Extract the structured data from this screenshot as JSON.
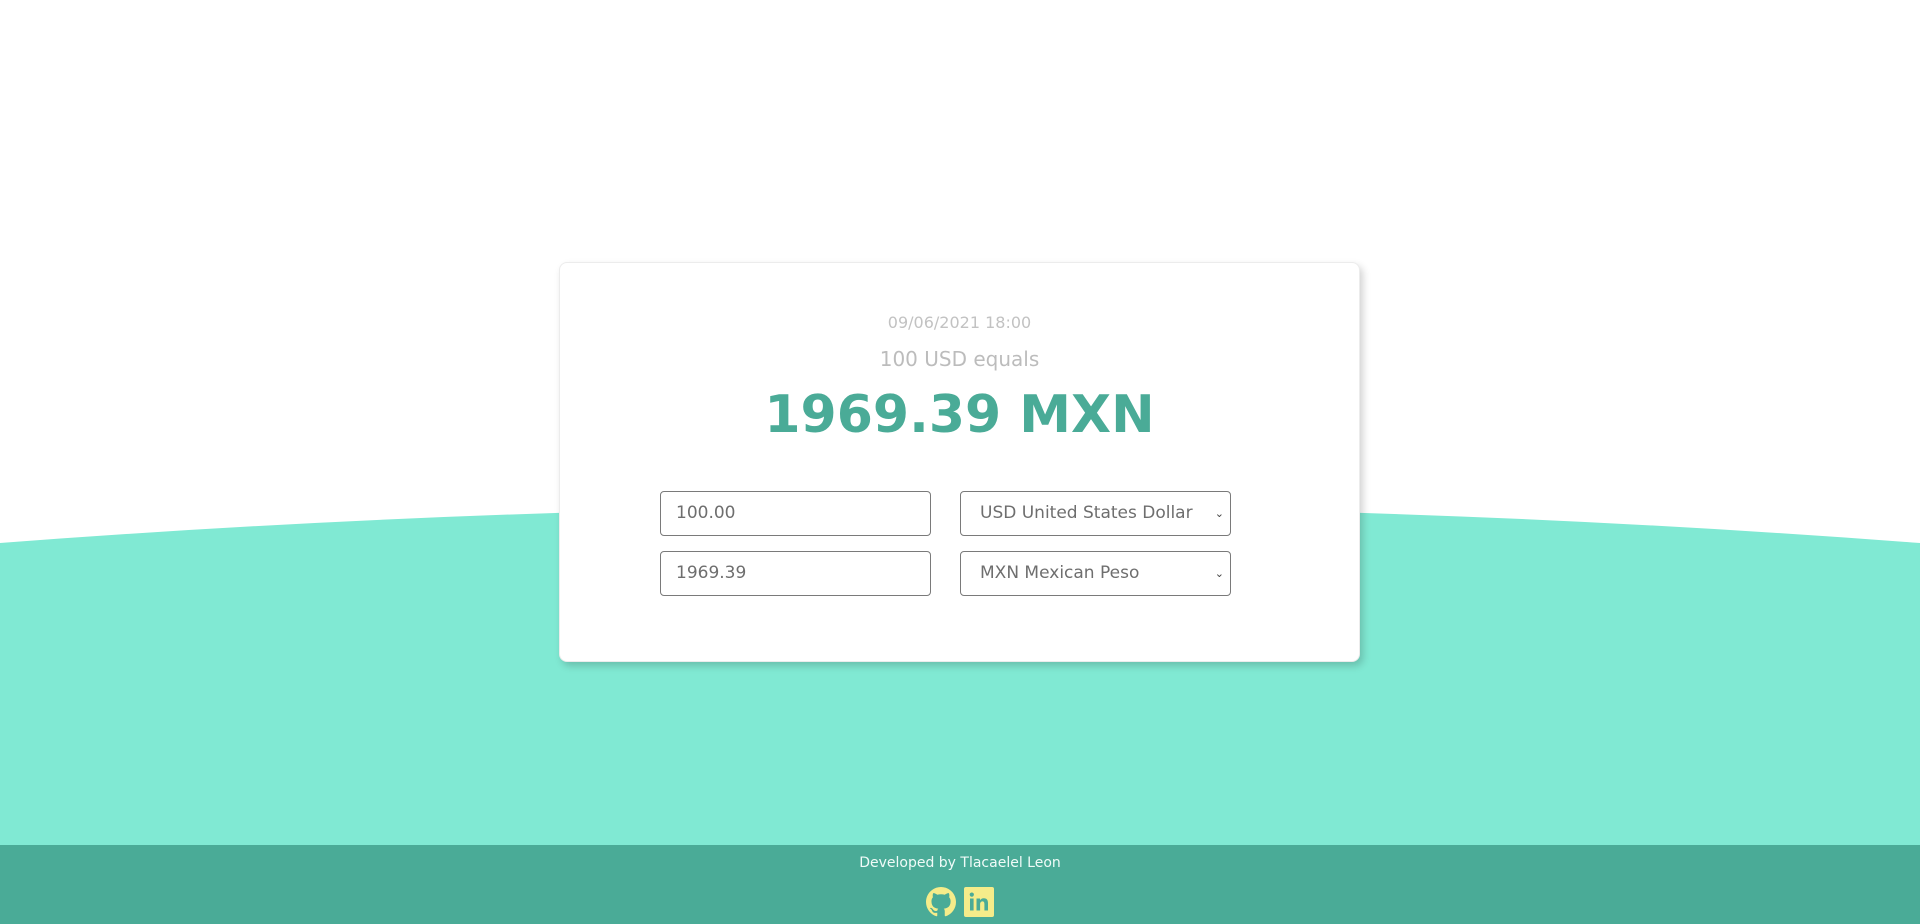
{
  "converter": {
    "timestamp": "09/06/2021 18:00",
    "equals_text": "100 USD equals",
    "result_text": "1969.39 MXN",
    "from": {
      "amount": "100.00",
      "currency": "USD United States Dollar"
    },
    "to": {
      "amount": "1969.39",
      "currency": "MXN Mexican Peso"
    }
  },
  "footer": {
    "credit": "Developed by Tlacaelel Leon",
    "icons": [
      "github-icon",
      "linkedin-icon"
    ]
  },
  "colors": {
    "wave": "#80e9d3",
    "accent": "#4aab97",
    "icon": "#f5ec8a"
  }
}
